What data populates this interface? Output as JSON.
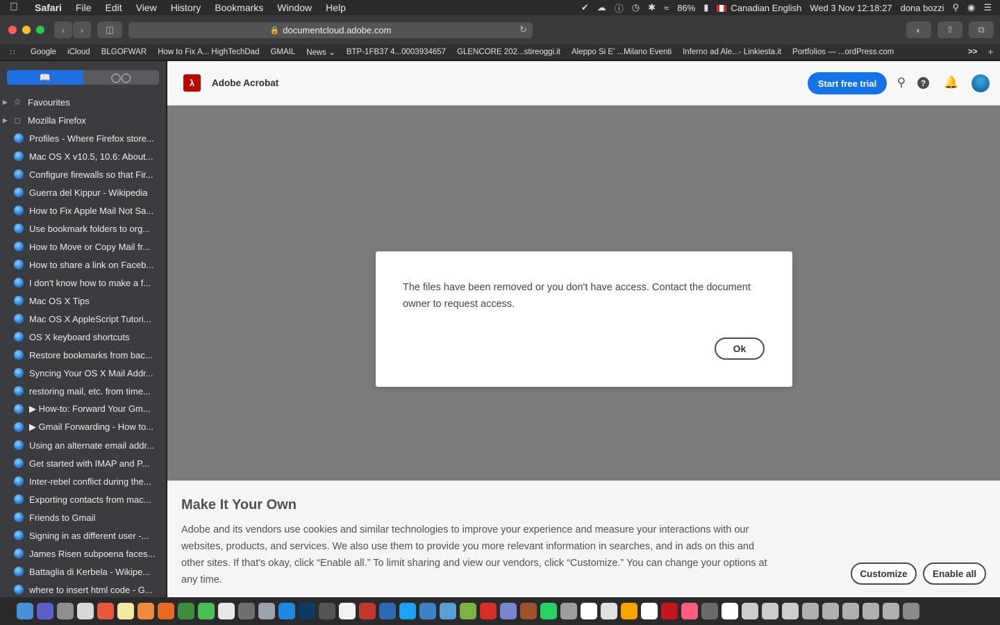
{
  "menubar": {
    "apple": "",
    "items": [
      "Safari",
      "File",
      "Edit",
      "View",
      "History",
      "Bookmarks",
      "Window",
      "Help"
    ],
    "battery": "86%",
    "input_source": "Canadian English",
    "datetime": "Wed 3 Nov  12:18:27",
    "user": "dona bozzi"
  },
  "toolbar": {
    "url": "documentcloud.adobe.com",
    "traffic_colors": [
      "#ff5f57",
      "#febc2e",
      "#28c840"
    ]
  },
  "favourites_bar": [
    "Google",
    "iCloud",
    "BLGOFWAR",
    "How to Fix A... HighTechDad",
    "GMAIL",
    "News ⌄",
    "BTP-1FB37 4...0003934657",
    "GLENCORE 202...stireoggi.it",
    "Aleppo Si E' ...Milano Eventi",
    "Inferno ad Ale...- Linkiesta.it",
    "Portfolios — ...ordPress.com"
  ],
  "sidebar": {
    "folders": [
      "Favourites",
      "Mozilla Firefox"
    ],
    "items": [
      "Profiles - Where Firefox store...",
      "Mac OS X v10.5, 10.6: About...",
      "Configure firewalls so that Fir...",
      "Guerra del Kippur - Wikipedia",
      "How to Fix Apple Mail Not Sa...",
      "Use bookmark folders to org...",
      "How to Move or Copy Mail fr...",
      "How to share a link on Faceb...",
      "I don't know how to make a f...",
      "Mac OS X Tips",
      "Mac OS X AppleScript Tutori...",
      "OS X keyboard shortcuts",
      "Restore bookmarks from bac...",
      "Syncing Your OS X Mail Addr...",
      "restoring mail, etc. from time...",
      "▶ How-to: Forward Your Gm...",
      "▶ Gmail Forwarding - How to...",
      "Using an alternate email addr...",
      "Get started with IMAP and P...",
      "Inter-rebel conflict during the...",
      "Exporting contacts from mac...",
      "Friends to Gmail",
      "Signing in as different user -...",
      "James Risen subpoena faces...",
      "Battaglia di Kerbela - Wikipe...",
      "where to insert html code - G..."
    ]
  },
  "app": {
    "name": "Adobe Acrobat",
    "trial_label": "Start free trial",
    "brand_color": "#b30b00",
    "accent_color": "#1473e6"
  },
  "dialog": {
    "message": "The files have been removed or you don't have access. Contact the document owner to request access.",
    "ok_label": "Ok"
  },
  "cookie": {
    "title": "Make It Your Own",
    "text": "Adobe and its vendors use cookies and similar technologies to improve your experience and measure your interactions with our websites, products, and services. We also use them to provide you more relevant information in searches, and in ads on this and other sites. If that's okay, click “Enable all.” To limit sharing and view our vendors, click “Customize.” You can change your options at any time.",
    "customize_label": "Customize",
    "enable_label": "Enable all"
  },
  "dock_colors": [
    "#4a90d9",
    "#5b5fc7",
    "#8e8e93",
    "#d8d8d8",
    "#e9573f",
    "#f5e8a0",
    "#f08a3c",
    "#e66a1f",
    "#3c8d3c",
    "#47c153",
    "#e8e8e8",
    "#6f6f6f",
    "#9aa3ad",
    "#1e88e5",
    "#0d3b66",
    "#555555",
    "#f2f2f2",
    "#c0392b",
    "#2e6ab3",
    "#1da1f2",
    "#3b82c4",
    "#5aa0d6",
    "#7cb342",
    "#d93025",
    "#7986cb",
    "#a0522d",
    "#25d366",
    "#9e9e9e",
    "#ffffff",
    "#e0e0e0",
    "#f7a600",
    "#ffffff",
    "#c5161d",
    "#fc5c7d",
    "#6a6a6a",
    "#ffffff",
    "#cccccc",
    "#cccccc",
    "#cccccc",
    "#b0b0b0",
    "#b0b0b0",
    "#b0b0b0",
    "#b0b0b0",
    "#b0b0b0",
    "#8a8a8a"
  ]
}
